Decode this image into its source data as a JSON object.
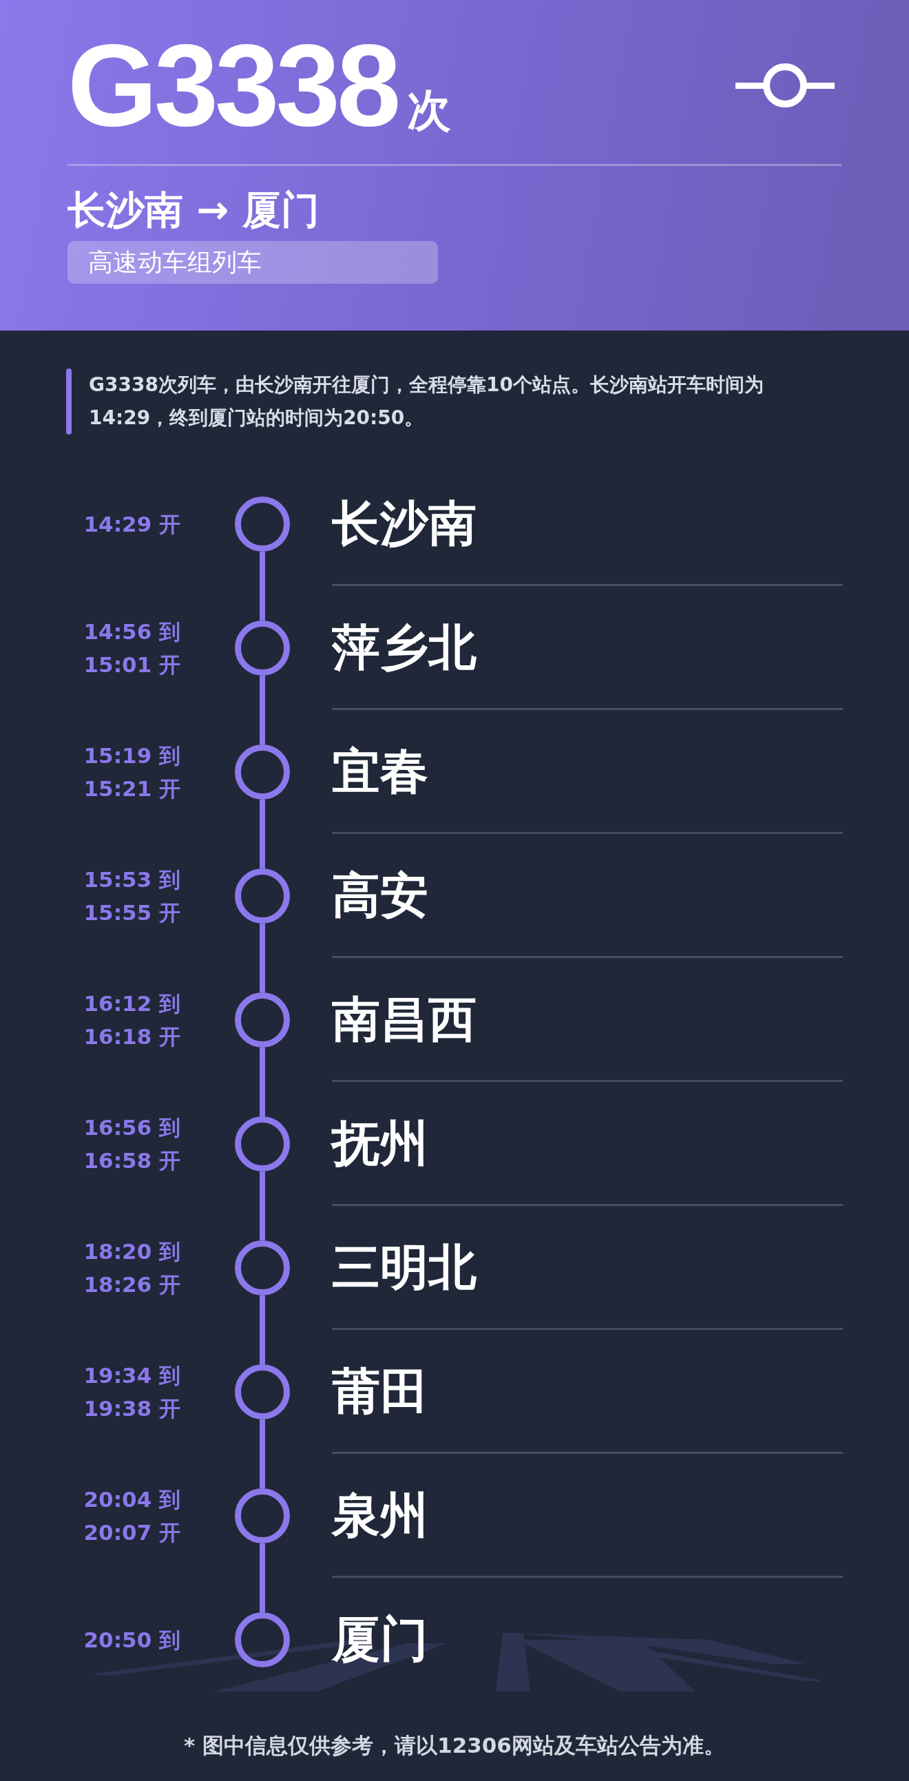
{
  "train": {
    "number": "G3338",
    "suffix": "次",
    "route_from": "长沙南",
    "route_arrow": "→",
    "route_to": "厦门",
    "type": "高速动车组列车"
  },
  "description": "G3338次列车，由长沙南开往厦门，全程停靠10个站点。长沙南站开车时间为14:29，终到厦门站的时间为20:50。",
  "stops": [
    {
      "name": "长沙南",
      "times": [
        "14:29 开"
      ]
    },
    {
      "name": "萍乡北",
      "times": [
        "14:56 到",
        "15:01 开"
      ]
    },
    {
      "name": "宜春",
      "times": [
        "15:19 到",
        "15:21 开"
      ]
    },
    {
      "name": "高安",
      "times": [
        "15:53 到",
        "15:55 开"
      ]
    },
    {
      "name": "南昌西",
      "times": [
        "16:12 到",
        "16:18 开"
      ]
    },
    {
      "name": "抚州",
      "times": [
        "16:56 到",
        "16:58 开"
      ]
    },
    {
      "name": "三明北",
      "times": [
        "18:20 到",
        "18:26 开"
      ]
    },
    {
      "name": "莆田",
      "times": [
        "19:34 到",
        "19:38 开"
      ]
    },
    {
      "name": "泉州",
      "times": [
        "20:04 到",
        "20:07 开"
      ]
    },
    {
      "name": "厦门",
      "times": [
        "20:50 到"
      ]
    }
  ],
  "footnote": "* 图中信息仅供参考，请以12306网站及车站公告为准。"
}
